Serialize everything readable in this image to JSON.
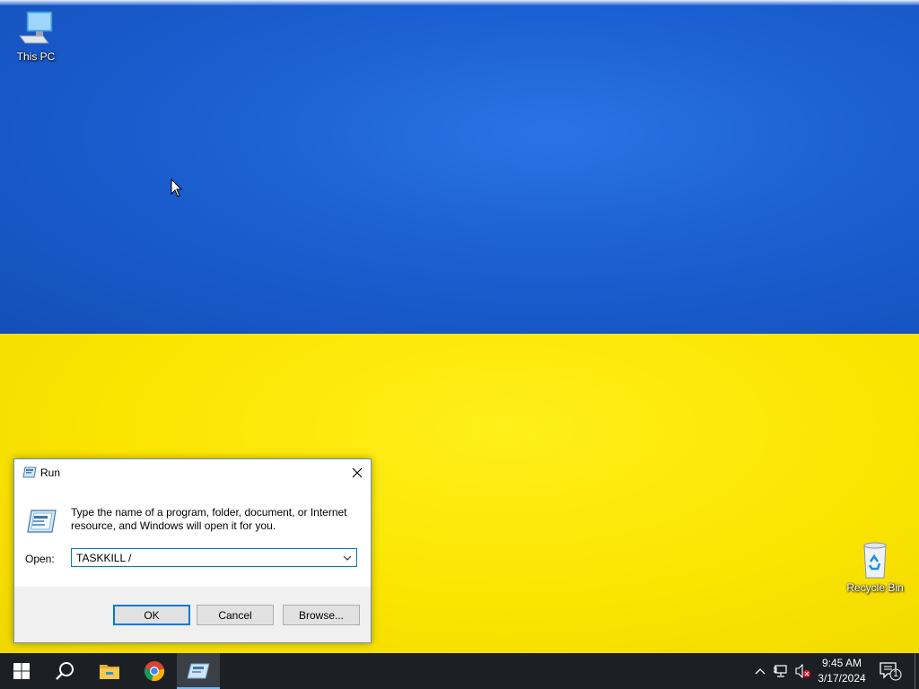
{
  "desktop": {
    "icons": [
      {
        "label": "This PC",
        "icon": "computer-icon"
      },
      {
        "label": "Recycle Bin",
        "icon": "recycle-bin-icon"
      }
    ],
    "wallpaper": {
      "top_color": "#1b5fd2",
      "bottom_color": "#fbe400"
    }
  },
  "run_dialog": {
    "title": "Run",
    "description": "Type the name of a program, folder, document, or Internet resource, and Windows will open it for you.",
    "open_label": "Open:",
    "input_value": "TASKKILL /",
    "buttons": {
      "ok": "OK",
      "cancel": "Cancel",
      "browse": "Browse..."
    }
  },
  "taskbar": {
    "items": [
      {
        "name": "start",
        "icon": "windows-logo-icon"
      },
      {
        "name": "search",
        "icon": "search-icon"
      },
      {
        "name": "file-explorer",
        "icon": "folder-icon"
      },
      {
        "name": "chrome",
        "icon": "chrome-icon"
      },
      {
        "name": "run",
        "icon": "run-icon",
        "active": true
      }
    ],
    "tray": {
      "time": "9:45 AM",
      "date": "3/17/2024",
      "notification_count": "1"
    }
  },
  "colors": {
    "accent": "#0078d7",
    "taskbar": "#1c2024"
  }
}
